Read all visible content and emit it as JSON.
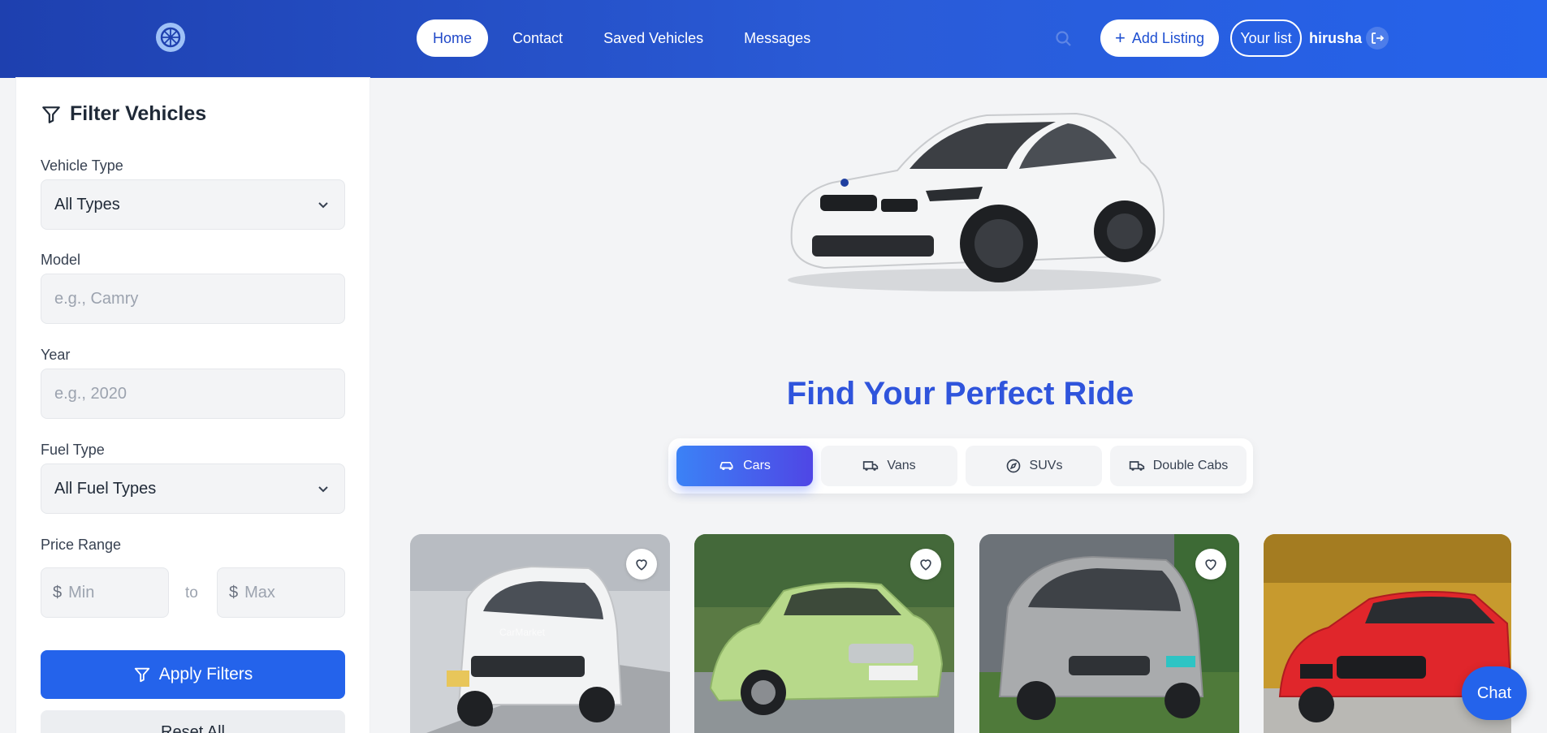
{
  "header": {
    "logo_icon": "wheel-icon",
    "nav": [
      {
        "label": "Home",
        "active": true
      },
      {
        "label": "Contact",
        "active": false
      },
      {
        "label": "Saved Vehicles",
        "active": false
      },
      {
        "label": "Messages",
        "active": false
      }
    ],
    "add_listing_label": "Add Listing",
    "your_list_label": "Your list",
    "username": "hirusha"
  },
  "sidebar": {
    "title": "Filter Vehicles",
    "vehicle_type": {
      "label": "Vehicle Type",
      "value": "All Types"
    },
    "model": {
      "label": "Model",
      "placeholder": "e.g., Camry"
    },
    "year": {
      "label": "Year",
      "placeholder": "e.g., 2020"
    },
    "fuel_type": {
      "label": "Fuel Type",
      "value": "All Fuel Types"
    },
    "price_range": {
      "label": "Price Range",
      "currency": "$",
      "min_placeholder": "Min",
      "max_placeholder": "Max",
      "to_text": "to"
    },
    "apply_label": "Apply Filters",
    "reset_label": "Reset All"
  },
  "main": {
    "headline": "Find Your Perfect Ride",
    "tabs": [
      {
        "label": "Cars",
        "icon": "car-icon",
        "active": true
      },
      {
        "label": "Vans",
        "icon": "van-icon",
        "active": false
      },
      {
        "label": "SUVs",
        "icon": "compass-icon",
        "active": false
      },
      {
        "label": "Double Cabs",
        "icon": "truck-icon",
        "active": false
      }
    ],
    "listings": [
      {
        "color": "#f2f3f4",
        "watermark": "CarMarket"
      },
      {
        "color": "#b7d98a"
      },
      {
        "color": "#a9abad"
      },
      {
        "color": "#e0262b"
      }
    ]
  },
  "chat_label": "Chat",
  "colors": {
    "primary": "#2463eb",
    "header_start": "#1e40af",
    "header_end": "#2563eb",
    "headline": "#2f54dc"
  }
}
